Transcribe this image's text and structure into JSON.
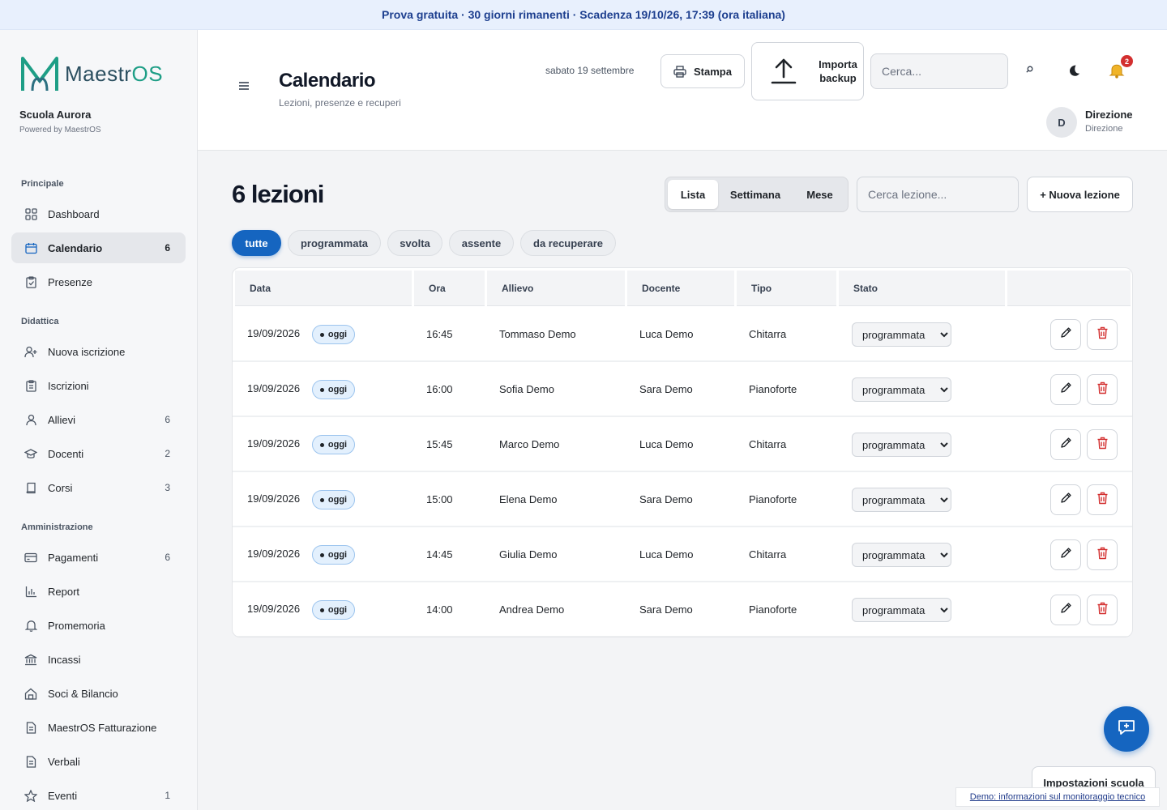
{
  "banner": {
    "text": "Prova gratuita · 30 giorni rimanenti · Scadenza 19/10/26, 17:39 (ora italiana)"
  },
  "sidebar": {
    "logo_text": "Maestr",
    "logo_text_accent": "OS",
    "school_name": "Scuola Aurora",
    "powered_by": "Powered by MaestrOS",
    "sections": [
      {
        "title": "Principale"
      },
      {
        "title": "Didattica"
      },
      {
        "title": "Amministrazione"
      }
    ],
    "items": [
      {
        "label": "Dashboard",
        "icon": "grid-icon",
        "count": ""
      },
      {
        "label": "Calendario",
        "icon": "calendar-icon",
        "count": "6",
        "active": true
      },
      {
        "label": "Presenze",
        "icon": "clipboard-check-icon",
        "count": ""
      },
      {
        "label": "Nuova iscrizione",
        "icon": "user-plus-icon",
        "count": ""
      },
      {
        "label": "Iscrizioni",
        "icon": "clipboard-icon",
        "count": ""
      },
      {
        "label": "Allievi",
        "icon": "user-icon",
        "count": "6"
      },
      {
        "label": "Docenti",
        "icon": "graduation-cap-icon",
        "count": "2"
      },
      {
        "label": "Corsi",
        "icon": "book-icon",
        "count": "3"
      },
      {
        "label": "Pagamenti",
        "icon": "credit-card-icon",
        "count": "6"
      },
      {
        "label": "Report",
        "icon": "bar-chart-icon",
        "count": ""
      },
      {
        "label": "Promemoria",
        "icon": "bell-icon",
        "count": ""
      },
      {
        "label": "Incassi",
        "icon": "bank-icon",
        "count": ""
      },
      {
        "label": "Soci & Bilancio",
        "icon": "home-icon",
        "count": ""
      },
      {
        "label": "MaestrOS Fatturazione",
        "icon": "document-icon",
        "count": ""
      },
      {
        "label": "Verbali",
        "icon": "document-icon",
        "count": ""
      },
      {
        "label": "Eventi",
        "icon": "star-icon",
        "count": "1"
      }
    ]
  },
  "header": {
    "menu_icon": "hamburger-icon",
    "title": "Calendario",
    "subtitle": "Lezioni, presenze e recuperi",
    "date": "sabato 19 settembre",
    "print_label": "Stampa",
    "import_label_1": "Importa",
    "import_label_2": "backup",
    "search_placeholder": "Cerca...",
    "notification_count": "2",
    "user_initial": "D",
    "user_name": "Direzione",
    "user_role": "Direzione"
  },
  "content": {
    "count_title": "6 lezioni",
    "views": [
      "Lista",
      "Settimana",
      "Mese"
    ],
    "active_view": "Lista",
    "search_placeholder": "Cerca lezione...",
    "new_lesson_label": "+ Nuova lezione",
    "filters": [
      "tutte",
      "programmata",
      "svolta",
      "assente",
      "da recuperare"
    ],
    "active_filter": "tutte"
  },
  "table": {
    "columns": [
      "Data",
      "Ora",
      "Allievo",
      "Docente",
      "Tipo",
      "Stato",
      ""
    ],
    "today_label": "oggi",
    "status_options": [
      "programmata",
      "svolta",
      "assente",
      "da recuperare"
    ],
    "rows": [
      {
        "data": "19/09/2026",
        "ora": "16:45",
        "allievo": "Tommaso Demo",
        "docente": "Luca Demo",
        "tipo": "Chitarra",
        "stato": "programmata"
      },
      {
        "data": "19/09/2026",
        "ora": "16:00",
        "allievo": "Sofia Demo",
        "docente": "Sara Demo",
        "tipo": "Pianoforte",
        "stato": "programmata"
      },
      {
        "data": "19/09/2026",
        "ora": "15:45",
        "allievo": "Marco Demo",
        "docente": "Luca Demo",
        "tipo": "Chitarra",
        "stato": "programmata"
      },
      {
        "data": "19/09/2026",
        "ora": "15:00",
        "allievo": "Elena Demo",
        "docente": "Sara Demo",
        "tipo": "Pianoforte",
        "stato": "programmata"
      },
      {
        "data": "19/09/2026",
        "ora": "14:45",
        "allievo": "Giulia Demo",
        "docente": "Luca Demo",
        "tipo": "Chitarra",
        "stato": "programmata"
      },
      {
        "data": "19/09/2026",
        "ora": "14:00",
        "allievo": "Andrea Demo",
        "docente": "Sara Demo",
        "tipo": "Pianoforte",
        "stato": "programmata"
      }
    ]
  },
  "footer": {
    "settings_label": "Impostazioni scuola",
    "demo_link": "Demo: informazioni sul monitoraggio tecnico"
  },
  "colors": {
    "accent": "#1565c0",
    "logo_teal": "#1e9e86",
    "danger": "#d32f2f"
  }
}
